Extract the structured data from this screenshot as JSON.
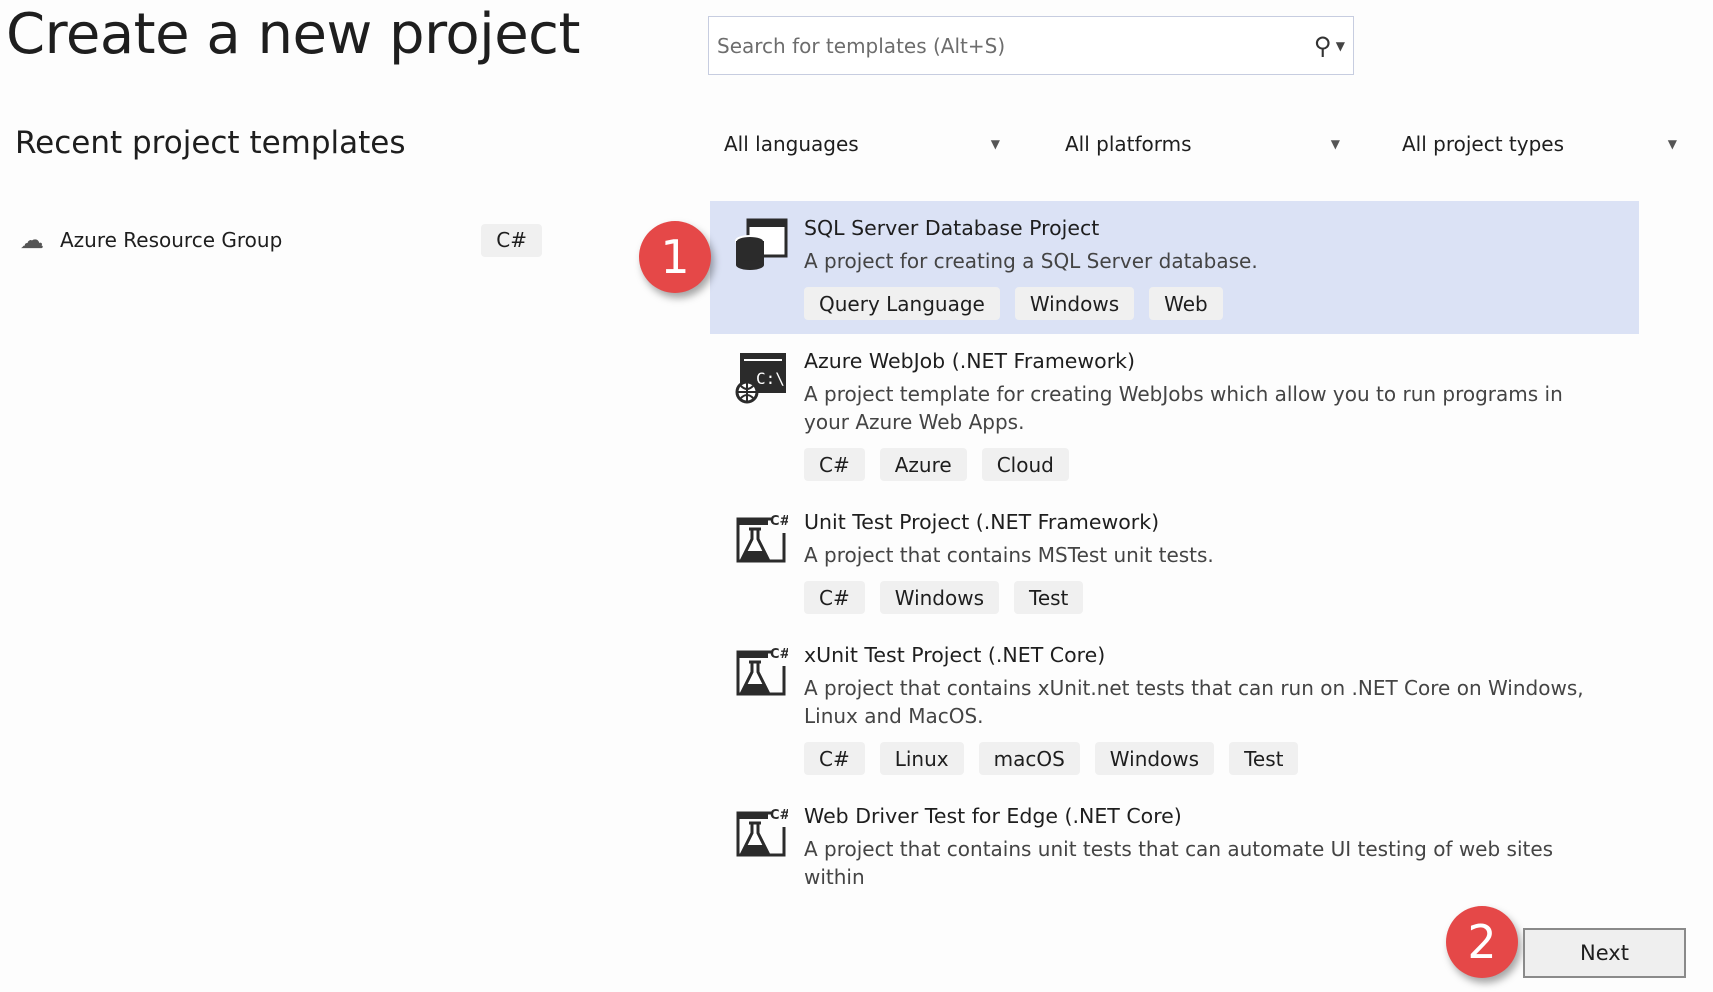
{
  "header": {
    "title": "Create a new project",
    "search_placeholder": "Search for templates (Alt+S)"
  },
  "recent": {
    "heading": "Recent project templates",
    "items": [
      {
        "name": "Azure Resource Group",
        "icon": "cloud-icon",
        "tag": "C#"
      }
    ]
  },
  "filters": {
    "language": "All languages",
    "platform": "All platforms",
    "project_type": "All project types"
  },
  "templates": [
    {
      "title": "SQL Server Database Project",
      "description": "A project for creating a SQL Server database.",
      "tags": [
        "Query Language",
        "Windows",
        "Web"
      ],
      "icon": "database-icon",
      "selected": true
    },
    {
      "title": "Azure WebJob (.NET Framework)",
      "description": "A project template for creating WebJobs which allow you to run programs in your Azure Web Apps.",
      "tags": [
        "C#",
        "Azure",
        "Cloud"
      ],
      "icon": "webjob-console-icon"
    },
    {
      "title": "Unit Test Project (.NET Framework)",
      "description": "A project that contains MSTest unit tests.",
      "tags": [
        "C#",
        "Windows",
        "Test"
      ],
      "icon": "test-flask-icon"
    },
    {
      "title": "xUnit Test Project (.NET Core)",
      "description": "A project that contains xUnit.net tests that can run on .NET Core on Windows, Linux and MacOS.",
      "tags": [
        "C#",
        "Linux",
        "macOS",
        "Windows",
        "Test"
      ],
      "icon": "test-flask-icon"
    },
    {
      "title": "Web Driver Test for Edge (.NET Core)",
      "description": "A project that contains unit tests that can automate UI testing of web sites within",
      "tags": [],
      "icon": "test-flask-icon"
    }
  ],
  "annotations": {
    "step1": "1",
    "step2": "2",
    "color": "#e54848"
  },
  "colors": {
    "selected_row": "#dbe2f5",
    "tag_bg": "#f0f0f0"
  },
  "footer": {
    "next_label": "Next"
  }
}
